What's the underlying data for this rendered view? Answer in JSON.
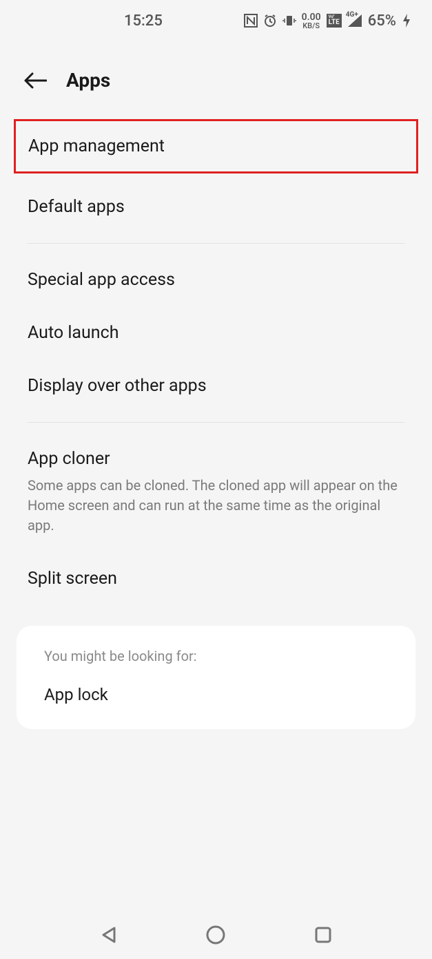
{
  "status": {
    "time": "15:25",
    "data_rate": "0.00",
    "data_unit": "KB/S",
    "volte_top": "Vo\"",
    "volte_bot": "LTE",
    "signal_label": "4G+",
    "battery": "65%"
  },
  "header": {
    "title": "Apps"
  },
  "items": {
    "app_management": "App management",
    "default_apps": "Default apps",
    "special_app_access": "Special app access",
    "auto_launch": "Auto launch",
    "display_over": "Display over other apps",
    "app_cloner": "App cloner",
    "app_cloner_sub": "Some apps can be cloned. The cloned app will appear on the Home screen and can run at the same time as the original app.",
    "split_screen": "Split screen"
  },
  "suggest": {
    "hint": "You might be looking for:",
    "app_lock": "App lock"
  }
}
